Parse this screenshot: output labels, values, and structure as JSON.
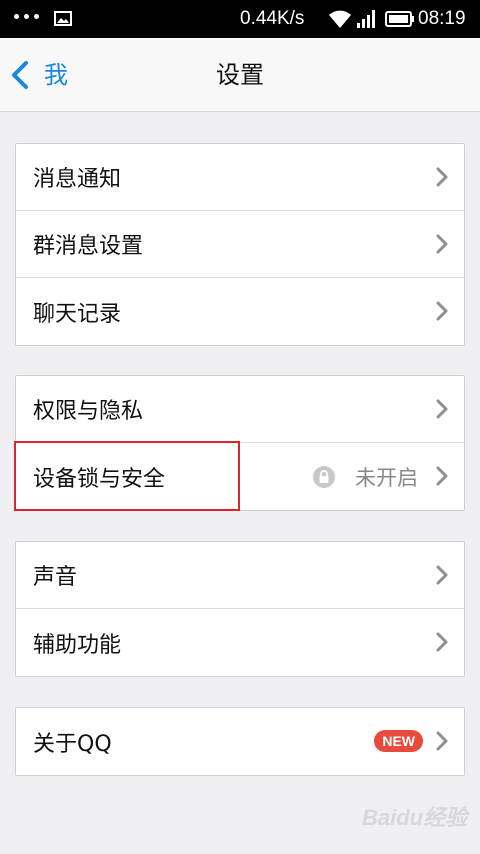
{
  "status_bar": {
    "net_speed": "0.44K/s",
    "time": "08:19"
  },
  "nav": {
    "back_label": "我",
    "title": "设置"
  },
  "groups": [
    {
      "items": [
        {
          "label": "消息通知"
        },
        {
          "label": "群消息设置"
        },
        {
          "label": "聊天记录"
        }
      ]
    },
    {
      "items": [
        {
          "label": "权限与隐私"
        },
        {
          "label": "设备锁与安全",
          "value": "未开启",
          "value_icon": "lock-icon"
        }
      ]
    },
    {
      "items": [
        {
          "label": "声音"
        },
        {
          "label": "辅助功能"
        }
      ]
    },
    {
      "items": [
        {
          "label": "关于QQ",
          "badge": "NEW"
        }
      ]
    }
  ],
  "watermark": "Baidu经验",
  "colors": {
    "accent": "#1a86e0",
    "badge": "#e84a3c",
    "highlight": "#d9262b",
    "background": "#efeff4"
  }
}
